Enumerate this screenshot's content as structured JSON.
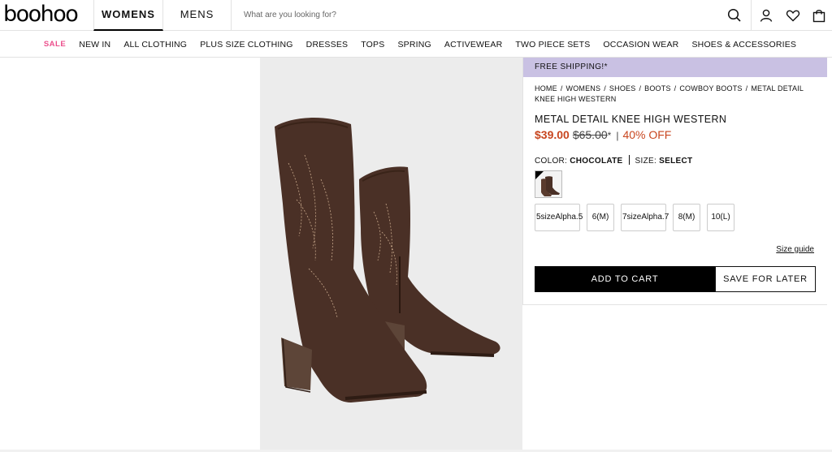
{
  "header": {
    "logo": "boohoo",
    "tabs": [
      {
        "label": "WOMENS",
        "active": true
      },
      {
        "label": "MENS",
        "active": false
      }
    ],
    "search": {
      "placeholder": "What are you looking for?",
      "value": ""
    },
    "icons": [
      "search-icon",
      "account-icon",
      "heart-icon",
      "bag-icon"
    ]
  },
  "nav": {
    "items": [
      "SALE",
      "NEW IN",
      "ALL CLOTHING",
      "PLUS SIZE CLOTHING",
      "DRESSES",
      "TOPS",
      "SPRING",
      "ACTIVEWEAR",
      "TWO PIECE SETS",
      "OCCASION WEAR",
      "SHOES & ACCESSORIES"
    ]
  },
  "product": {
    "shipping_banner": "FREE SHIPPING!*",
    "breadcrumb": [
      "HOME",
      "WOMENS",
      "SHOES",
      "BOOTS",
      "COWBOY BOOTS",
      "METAL DETAIL KNEE HIGH WESTERN"
    ],
    "breadcrumb_separator": "/",
    "title": "METAL DETAIL KNEE HIGH WESTERN",
    "price_now": "$39.00",
    "price_was": "$65.00",
    "price_star": "*",
    "price_divider": "|",
    "discount": "40% OFF",
    "color_label": "COLOR:",
    "color_value": "CHOCOLATE",
    "size_label": "SIZE:",
    "size_value": "SELECT",
    "sizes": [
      "5sizeAlpha.5",
      "6(M)",
      "7sizeAlpha.7",
      "8(M)",
      "10(L)"
    ],
    "size_guide": "Size guide",
    "add_to_cart": "ADD TO CART",
    "save_for_later": "SAVE FOR LATER"
  },
  "colors": {
    "accent_sale": "#ec4f8c",
    "price": "#c8461f",
    "shipping_bg": "#c9c1e3",
    "boot": "#4a3026"
  }
}
